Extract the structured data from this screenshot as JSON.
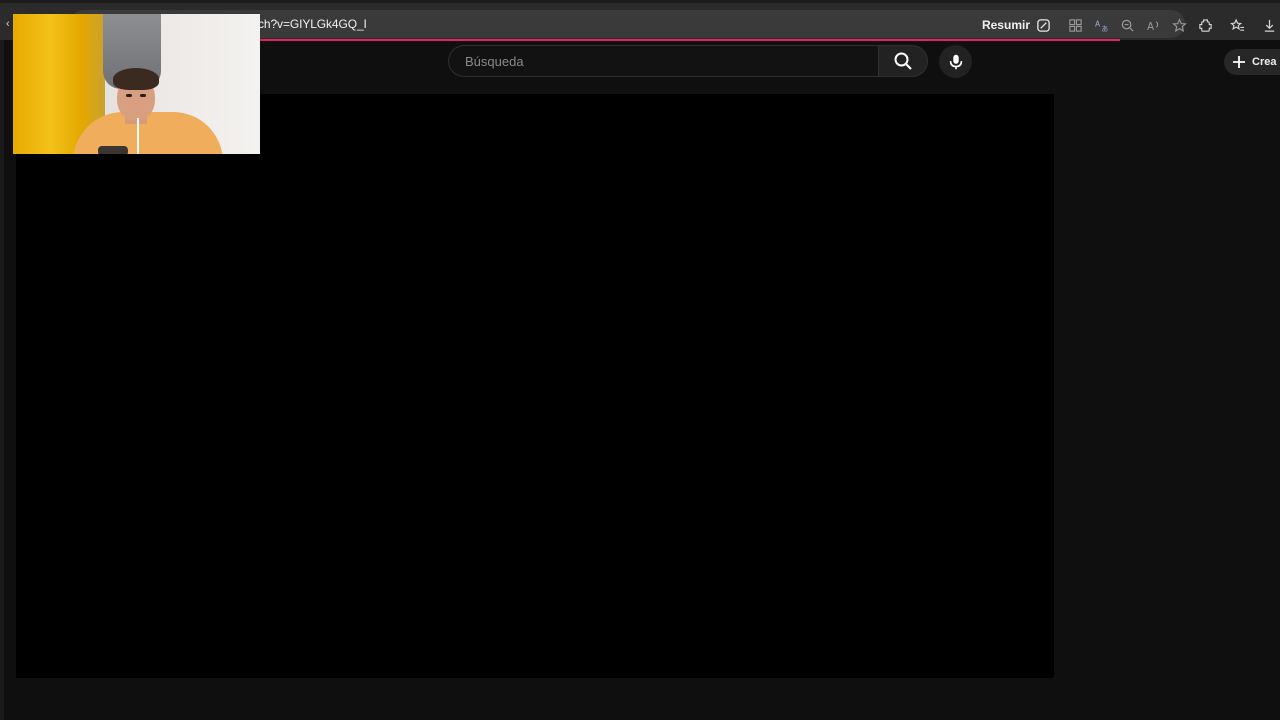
{
  "browser": {
    "url_visible": "ch?v=GIYLGk4GQ_I",
    "summarize_label": "Resumir",
    "toolbar_icons": [
      "summarize-icon",
      "grid-icon",
      "translate-icon",
      "zoom-icon",
      "read-aloud-icon",
      "favorite-star-icon",
      "extensions-icon",
      "favorites-icon",
      "download-icon"
    ],
    "loading_color": "#e0245e"
  },
  "youtube": {
    "search_placeholder": "Búsqueda",
    "create_label": "Crea"
  },
  "colors": {
    "page_bg": "#0f0f0f",
    "video_bg": "#000000",
    "accent": "#e0245e"
  }
}
